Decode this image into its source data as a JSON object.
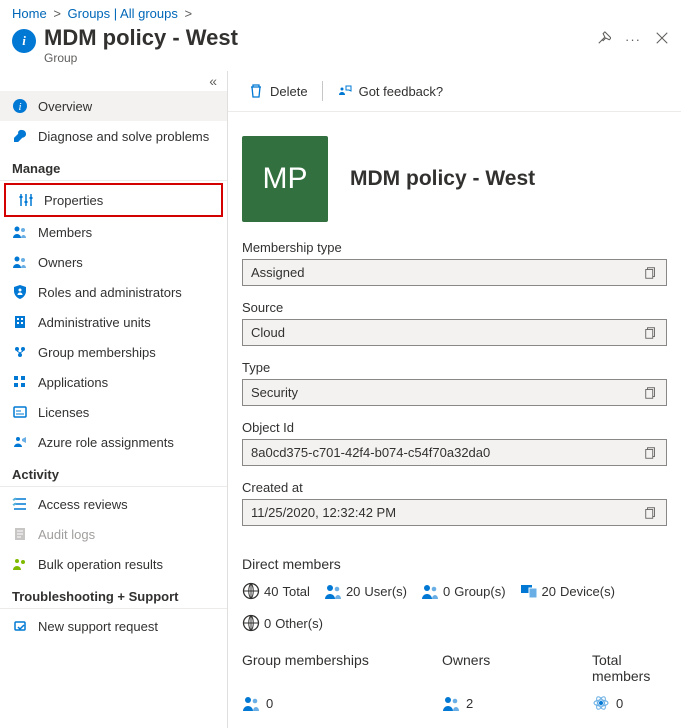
{
  "breadcrumb": {
    "home": "Home",
    "groups": "Groups | All groups"
  },
  "header": {
    "title": "MDM policy - West",
    "subtitle": "Group"
  },
  "sidebar": {
    "overview": "Overview",
    "diagnose": "Diagnose and solve problems",
    "manage_header": "Manage",
    "properties": "Properties",
    "members": "Members",
    "owners": "Owners",
    "roles": "Roles and administrators",
    "admin_units": "Administrative units",
    "group_memberships": "Group memberships",
    "applications": "Applications",
    "licenses": "Licenses",
    "azure_roles": "Azure role assignments",
    "activity_header": "Activity",
    "access_reviews": "Access reviews",
    "audit_logs": "Audit logs",
    "bulk_results": "Bulk operation results",
    "troubleshoot_header": "Troubleshooting + Support",
    "support_request": "New support request"
  },
  "toolbar": {
    "delete": "Delete",
    "feedback": "Got feedback?"
  },
  "hero": {
    "initials": "MP",
    "title": "MDM policy - West"
  },
  "fields": {
    "membership_type": {
      "label": "Membership type",
      "value": "Assigned"
    },
    "source": {
      "label": "Source",
      "value": "Cloud"
    },
    "type": {
      "label": "Type",
      "value": "Security"
    },
    "object_id": {
      "label": "Object Id",
      "value": "8a0cd375-c701-42f4-b074-c54f70a32da0"
    },
    "created_at": {
      "label": "Created at",
      "value": "11/25/2020, 12:32:42 PM"
    }
  },
  "direct_members": {
    "title": "Direct members",
    "total": {
      "value": "40",
      "label": "Total"
    },
    "users": {
      "value": "20",
      "label": "User(s)"
    },
    "groups": {
      "value": "0",
      "label": "Group(s)"
    },
    "devices": {
      "value": "20",
      "label": "Device(s)"
    },
    "others": {
      "value": "0",
      "label": "Other(s)"
    }
  },
  "summary": {
    "group_memberships": {
      "label": "Group memberships",
      "value": "0"
    },
    "owners": {
      "label": "Owners",
      "value": "2"
    },
    "total_members": {
      "label": "Total members",
      "value": "0"
    }
  }
}
